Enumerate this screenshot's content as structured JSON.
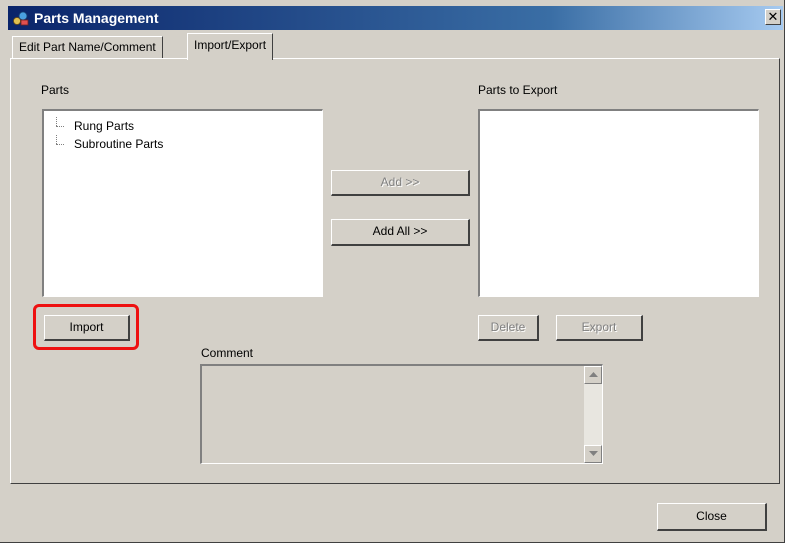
{
  "window": {
    "title": "Parts Management",
    "icons": {
      "app": "parts-app-icon",
      "close": "close-icon"
    },
    "close_glyph": "✕"
  },
  "tabs": [
    {
      "label": "Edit Part Name/Comment",
      "active": false
    },
    {
      "label": "Import/Export",
      "active": true
    }
  ],
  "parts": {
    "label": "Parts",
    "items": [
      "Rung Parts",
      "Subroutine Parts"
    ]
  },
  "export": {
    "label": "Parts to Export",
    "items": []
  },
  "buttons": {
    "add": "Add >>",
    "add_all": "Add All >>",
    "import": "Import",
    "delete": "Delete",
    "export": "Export",
    "close": "Close"
  },
  "comment": {
    "label": "Comment",
    "value": ""
  },
  "colors": {
    "highlight": "#ee1111",
    "titlebar_start": "#0a246a",
    "face": "#d4d0c8"
  }
}
